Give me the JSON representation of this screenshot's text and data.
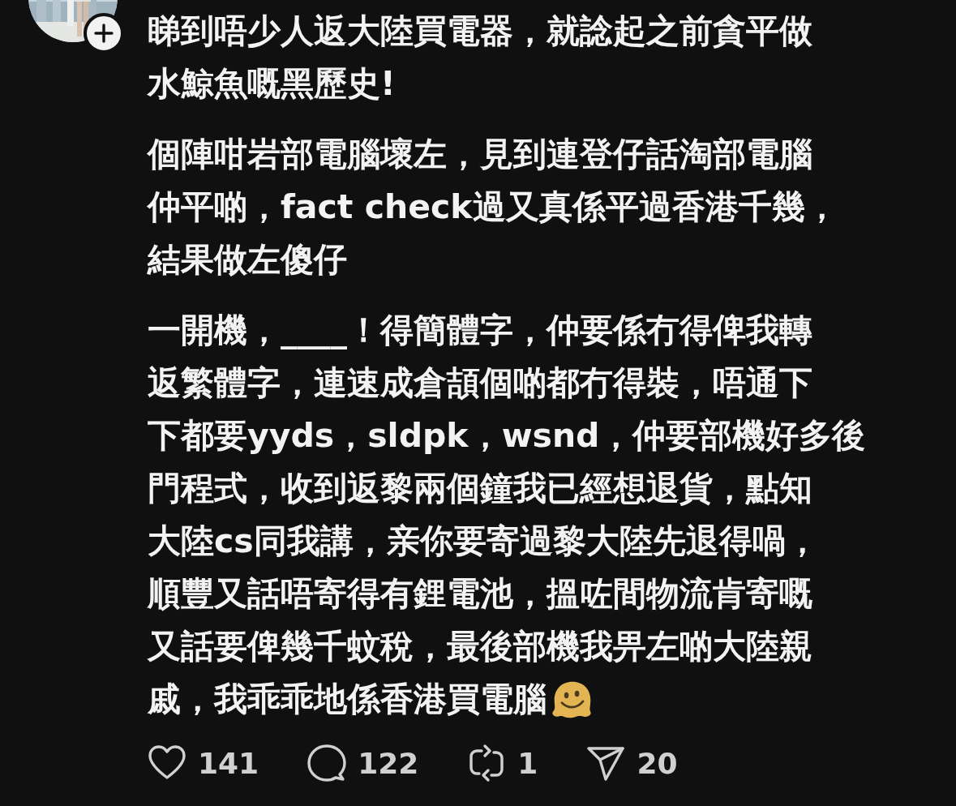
{
  "post": {
    "paragraphs": [
      {
        "lines": [
          "睇到唔少人返大陸買電器，就諗起之前貪平做",
          "水鯨魚嘅黑歷史!"
        ]
      },
      {
        "lines": [
          "個陣咁岩部電腦壞左，見到連登仔話淘部電腦",
          "仲平啲，fact check過又真係平過香港千幾，",
          "結果做左傻仔"
        ]
      },
      {
        "lines": [
          "一開機，____！得簡體字，仲要係冇得俾我轉",
          "返繁體字，連速成倉頡個啲都冇得裝，唔通下",
          "下都要yyds，sldpk，wsnd，仲要部機好多後",
          "門程式，收到返黎兩個鐘我已經想退貨，點知",
          "大陸cs同我講，亲你要寄過黎大陸先退得喎，",
          "順豐又話唔寄得有鋰電池，搵咗間物流肯寄嘅",
          "又話要俾幾千蚊稅，最後部機我畀左啲大陸親",
          "戚，我乖乖地係香港買電腦"
        ]
      }
    ]
  },
  "actions": [
    {
      "kind": "like",
      "count": "141"
    },
    {
      "kind": "reply",
      "count": "122"
    },
    {
      "kind": "repost",
      "count": "1"
    },
    {
      "kind": "share",
      "count": "20"
    }
  ]
}
